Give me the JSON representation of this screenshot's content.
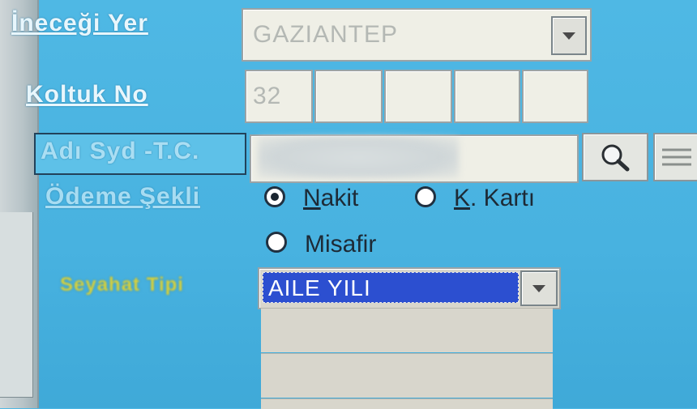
{
  "labels": {
    "inecegi_yer": "İneceği Yer",
    "koltuk_no": "Koltuk No",
    "adi_soyadi_tc": "Adı Syd -T.C.",
    "odeme_sekli": "Ödeme Şekli",
    "seyahat_tipi": "Seyahat Tipi"
  },
  "inecegi_yer": {
    "value": "GAZIANTEP"
  },
  "koltuk": {
    "seat_1": "32",
    "seat_2": "",
    "seat_3": "",
    "seat_4": "",
    "seat_5": ""
  },
  "payment": {
    "options": [
      {
        "label_first": "N",
        "label_rest": "akit",
        "checked": true
      },
      {
        "label_first": "K",
        "label_rest": ". Kartı",
        "checked": false
      },
      {
        "label": "Misafir",
        "checked": false
      }
    ]
  },
  "seyahat_tipi": {
    "selected": "AILE YILI"
  },
  "icons": {
    "search": "magnifier-icon",
    "list": "list-lines-icon"
  },
  "colors": {
    "background": "#4fb8e4",
    "selection": "#2c4fd0",
    "field": "#efefe6"
  }
}
